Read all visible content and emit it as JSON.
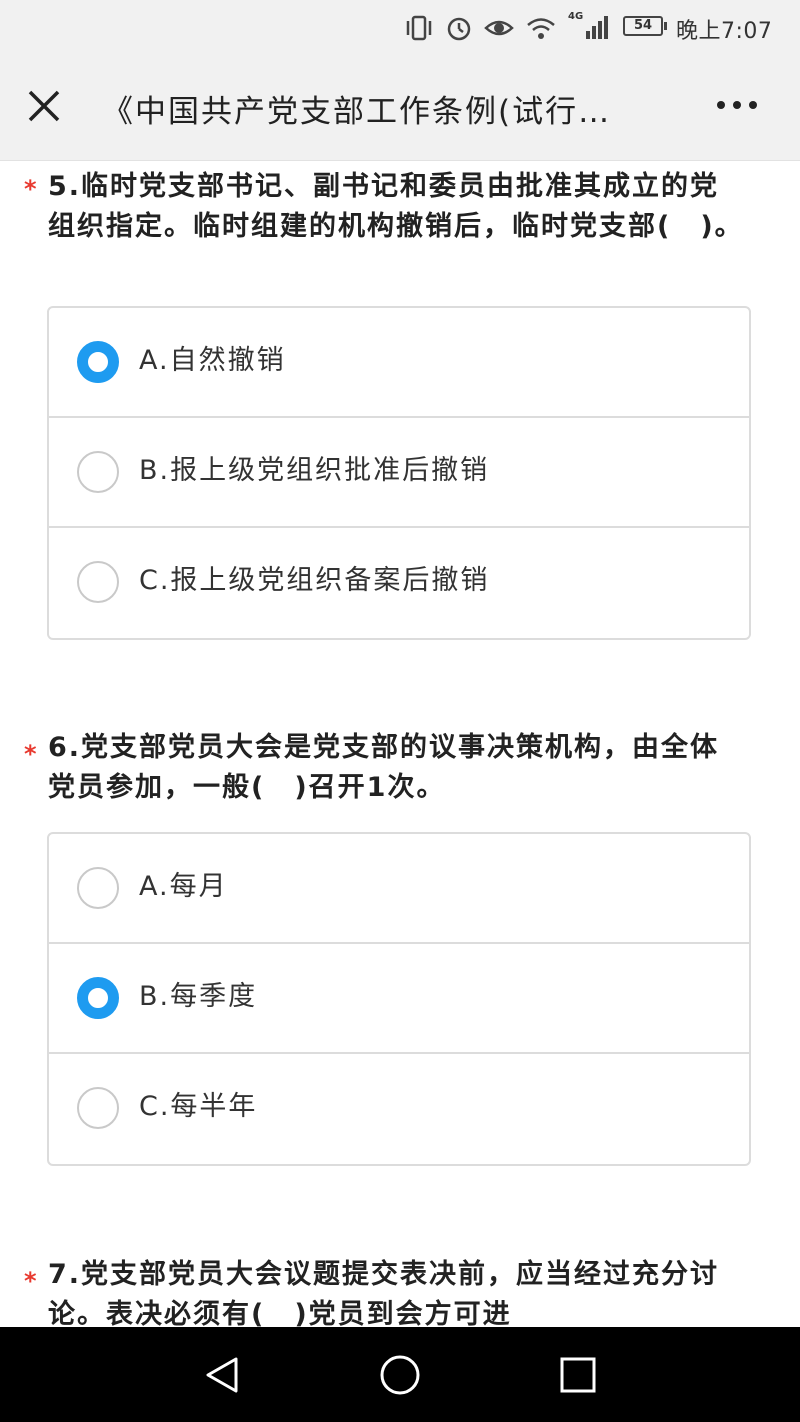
{
  "status": {
    "network": "4G",
    "battery": "54",
    "time": "晚上7:07"
  },
  "titlebar": {
    "title": "《中国共产党支部工作条例(试行…",
    "close_icon": "close-icon",
    "more_icon": "more-icon"
  },
  "colors": {
    "accent": "#1e9bf0",
    "required": "#e8392f",
    "bar_bg": "#f1f1f1",
    "border": "#dcdcdc"
  },
  "questions": [
    {
      "star": "*",
      "text": "5.临时党支部书记、副书记和委员由批准其成立的党组织指定。临时组建的机构撤销后，临时党支部(　)。",
      "options": [
        {
          "label": "A.自然撤销",
          "selected": true
        },
        {
          "label": "B.报上级党组织批准后撤销",
          "selected": false
        },
        {
          "label": "C.报上级党组织备案后撤销",
          "selected": false
        }
      ]
    },
    {
      "star": "*",
      "text": "6.党支部党员大会是党支部的议事决策机构，由全体党员参加，一般(　)召开1次。",
      "options": [
        {
          "label": "A.每月",
          "selected": false
        },
        {
          "label": "B.每季度",
          "selected": true
        },
        {
          "label": "C.每半年",
          "selected": false
        }
      ]
    },
    {
      "star": "*",
      "text": "7.党支部党员大会议题提交表决前，应当经过充分讨论。表决必须有(　)党员到会方可进"
    }
  ],
  "navbar": {
    "back_icon": "back-triangle-icon",
    "home_icon": "home-circle-icon",
    "recents_icon": "recents-square-icon"
  }
}
